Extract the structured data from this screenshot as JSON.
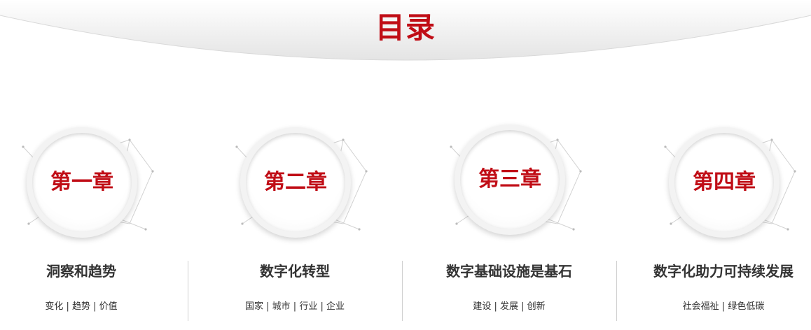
{
  "title": "目录",
  "chapters": [
    {
      "label": "第一章",
      "title": "洞察和趋势",
      "subtitle": "变化 | 趋势 | 价值"
    },
    {
      "label": "第二章",
      "title": "数字化转型",
      "subtitle": "国家 | 城市 | 行业 | 企业"
    },
    {
      "label": "第三章",
      "title": "数字基础设施是基石",
      "subtitle": "建设 | 发展 | 创新"
    },
    {
      "label": "第四章",
      "title": "数字化助力可持续发展",
      "subtitle": "社会福祉 | 绿色低碳"
    }
  ],
  "colors": {
    "accent": "#c00d16",
    "text": "#333333",
    "divider": "#cfcfcf"
  }
}
